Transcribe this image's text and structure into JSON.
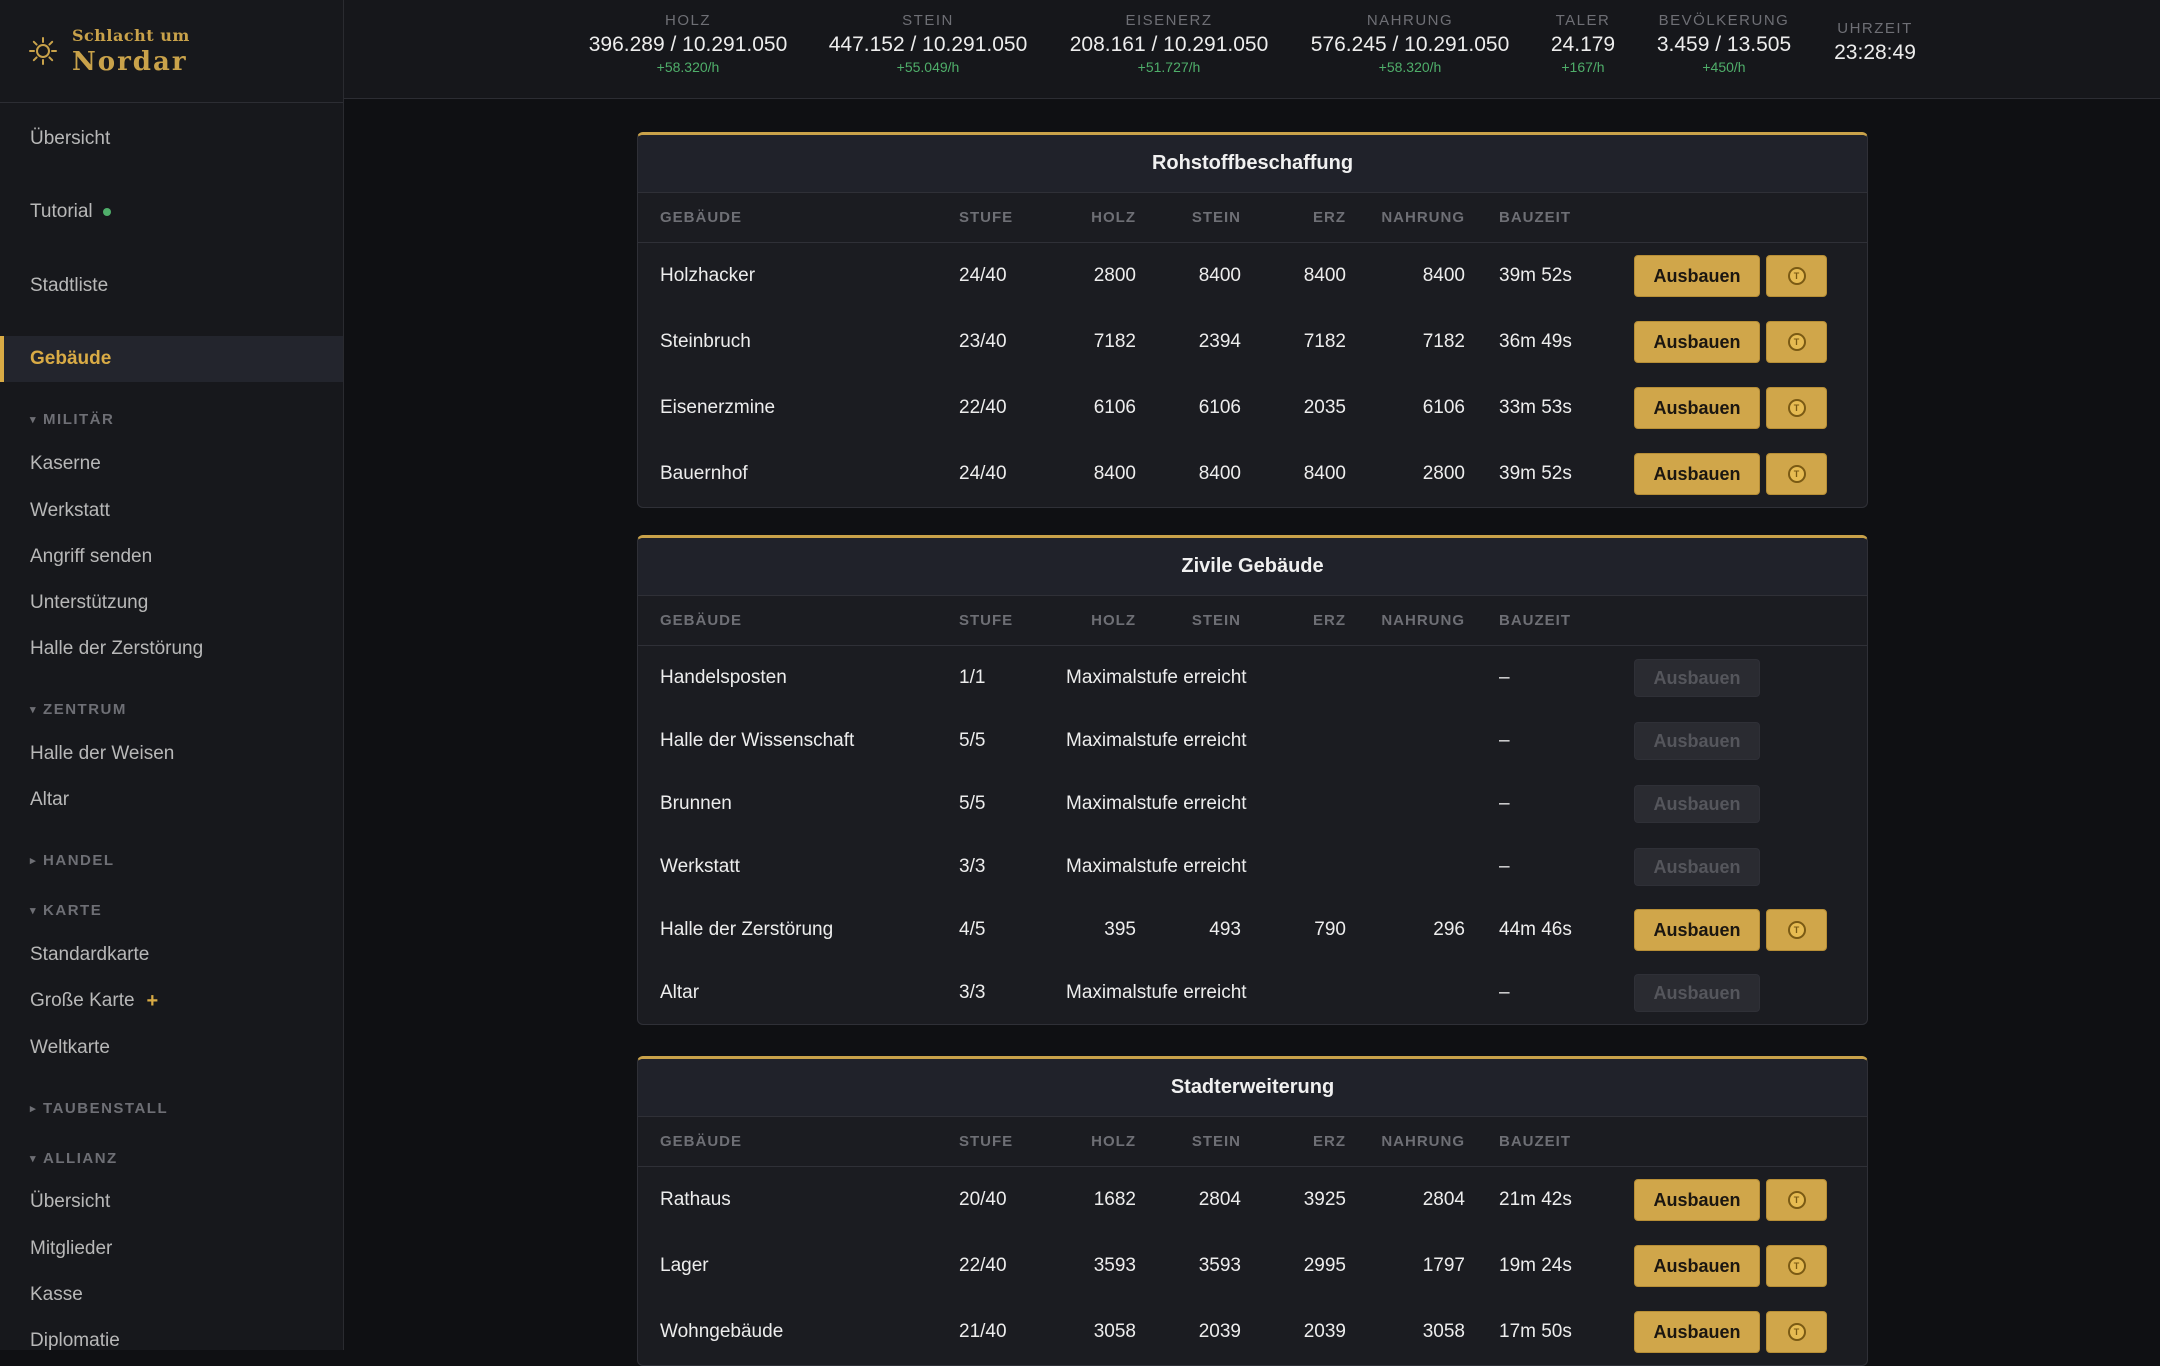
{
  "brand": {
    "small": "Schlacht um",
    "big": "Nordar"
  },
  "nav": {
    "uebersicht": "Übersicht",
    "tutorial": "Tutorial",
    "stadtliste": "Stadtliste",
    "gebaeude": "Gebäude",
    "militaer": "MILITÄR",
    "kaserne": "Kaserne",
    "werkstatt": "Werkstatt",
    "angriff": "Angriff senden",
    "unterstuetzung": "Unterstützung",
    "halle_zerstoerung": "Halle der Zerstörung",
    "zentrum": "ZENTRUM",
    "halle_weisen": "Halle der Weisen",
    "altar": "Altar",
    "handel": "HANDEL",
    "karte": "KARTE",
    "standardkarte": "Standardkarte",
    "grosse_karte": "Große Karte",
    "weltkarte": "Weltkarte",
    "taubenstall": "TAUBENSTALL",
    "allianz": "ALLIANZ",
    "allianz_uebersicht": "Übersicht",
    "mitglieder": "Mitglieder",
    "kasse": "Kasse",
    "diplomatie": "Diplomatie"
  },
  "stats": [
    {
      "label": "HOLZ",
      "value": "396.289 / 10.291.050",
      "rate": "+58.320/h"
    },
    {
      "label": "STEIN",
      "value": "447.152 / 10.291.050",
      "rate": "+55.049/h"
    },
    {
      "label": "EISENERZ",
      "value": "208.161 / 10.291.050",
      "rate": "+51.727/h"
    },
    {
      "label": "NAHRUNG",
      "value": "576.245 / 10.291.050",
      "rate": "+58.320/h"
    },
    {
      "label": "TALER",
      "value": "24.179",
      "rate": "+167/h"
    },
    {
      "label": "BEVÖLKERUNG",
      "value": "3.459 / 13.505",
      "rate": "+450/h"
    },
    {
      "label": "UHRZEIT",
      "value": "23:28:49"
    }
  ],
  "columns": {
    "gebaeude": "GEBÄUDE",
    "stufe": "STUFE",
    "holz": "HOLZ",
    "stein": "STEIN",
    "erz": "ERZ",
    "nahrung": "NAHRUNG",
    "bauzeit": "BAUZEIT"
  },
  "upgrade_label": "Ausbauen",
  "max_label": "Maximalstufe erreicht",
  "dash": "–",
  "panels": [
    {
      "title": "Rohstoffbeschaffung",
      "rows": [
        {
          "name": "Holzhacker",
          "level": "24/40",
          "holz": "2800",
          "stein": "8400",
          "erz": "8400",
          "nahrung": "8400",
          "time": "39m 52s"
        },
        {
          "name": "Steinbruch",
          "level": "23/40",
          "holz": "7182",
          "stein": "2394",
          "erz": "7182",
          "nahrung": "7182",
          "time": "36m 49s"
        },
        {
          "name": "Eisenerzmine",
          "level": "22/40",
          "holz": "6106",
          "stein": "6106",
          "erz": "2035",
          "nahrung": "6106",
          "time": "33m 53s"
        },
        {
          "name": "Bauernhof",
          "level": "24/40",
          "holz": "8400",
          "stein": "8400",
          "erz": "8400",
          "nahrung": "2800",
          "time": "39m 52s"
        }
      ]
    },
    {
      "title": "Zivile Gebäude",
      "rows": [
        {
          "name": "Handelsposten",
          "level": "1/1",
          "max": true
        },
        {
          "name": "Halle der Wissenschaft",
          "level": "5/5",
          "max": true
        },
        {
          "name": "Brunnen",
          "level": "5/5",
          "max": true
        },
        {
          "name": "Werkstatt",
          "level": "3/3",
          "max": true
        },
        {
          "name": "Halle der Zerstörung",
          "level": "4/5",
          "holz": "395",
          "stein": "493",
          "erz": "790",
          "nahrung": "296",
          "time": "44m 46s"
        },
        {
          "name": "Altar",
          "level": "3/3",
          "max": true
        }
      ]
    },
    {
      "title": "Stadterweiterung",
      "rows": [
        {
          "name": "Rathaus",
          "level": "20/40",
          "holz": "1682",
          "stein": "2804",
          "erz": "3925",
          "nahrung": "2804",
          "time": "21m 42s"
        },
        {
          "name": "Lager",
          "level": "22/40",
          "holz": "3593",
          "stein": "3593",
          "erz": "2995",
          "nahrung": "1797",
          "time": "19m 24s"
        },
        {
          "name": "Wohngebäude",
          "level": "21/40",
          "holz": "3058",
          "stein": "2039",
          "erz": "2039",
          "nahrung": "3058",
          "time": "17m 50s"
        }
      ]
    }
  ]
}
